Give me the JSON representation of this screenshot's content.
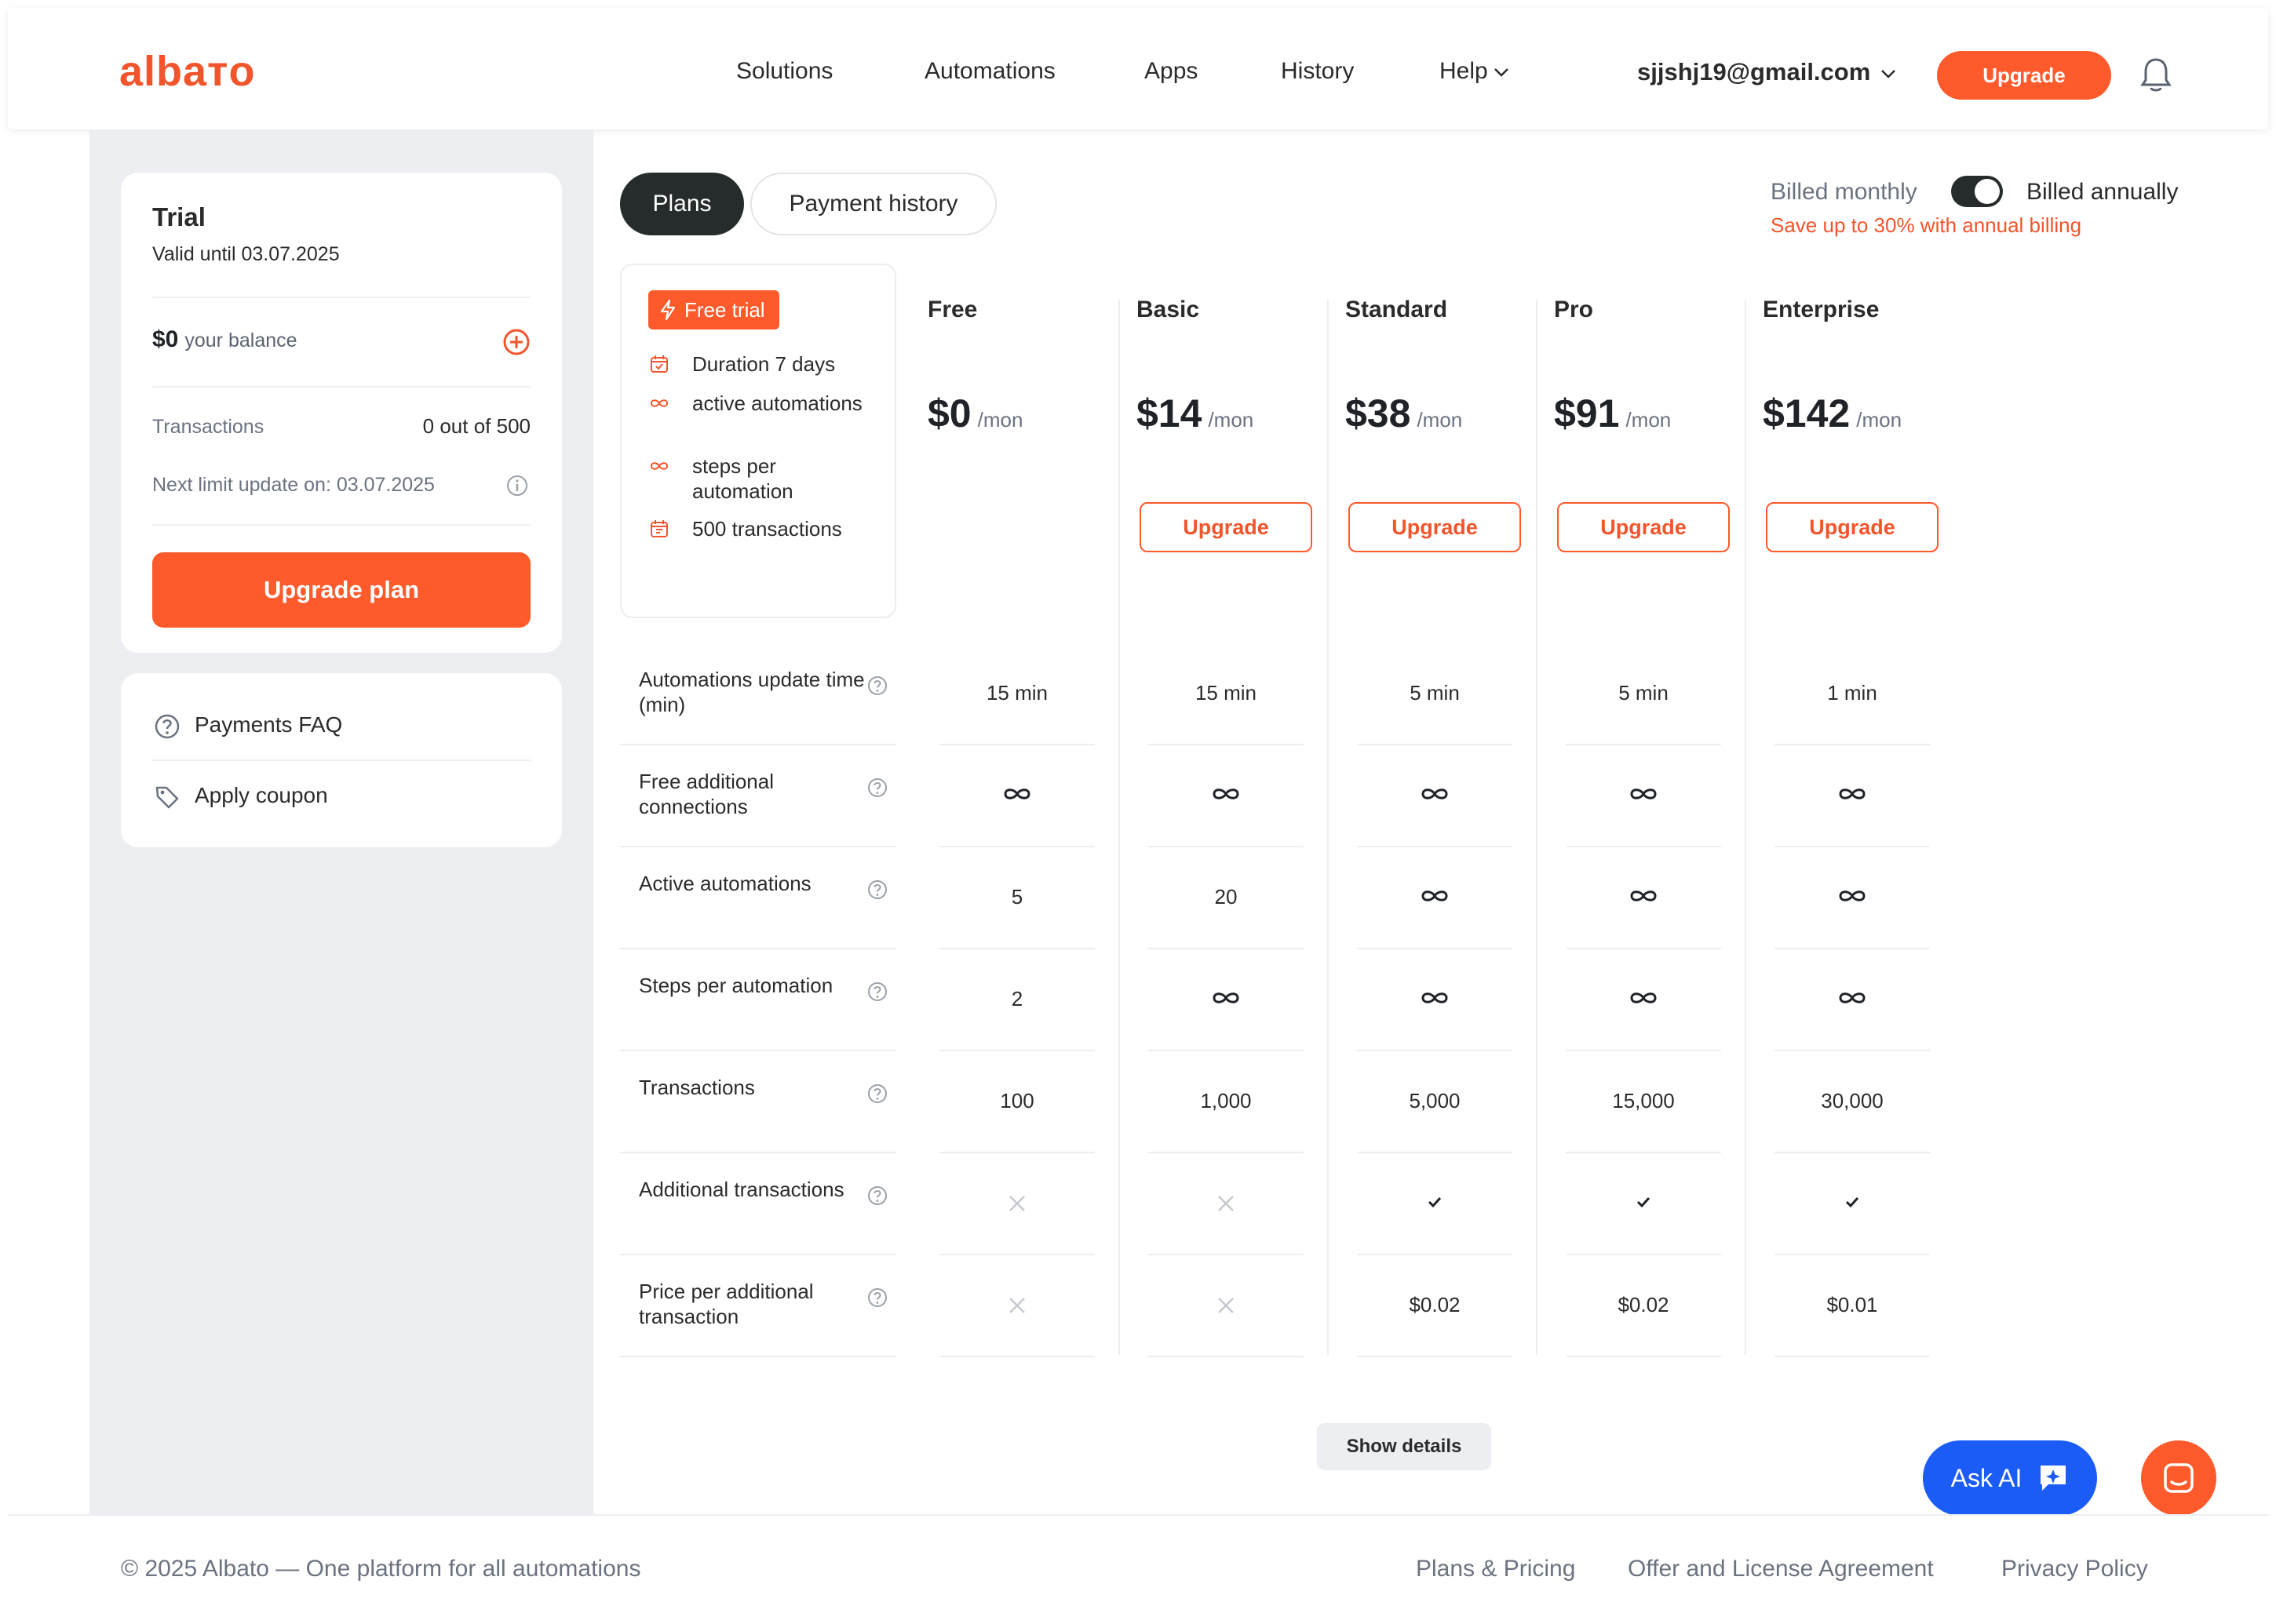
{
  "header": {
    "logo": "albaтo",
    "nav": [
      "Solutions",
      "Automations",
      "Apps",
      "History",
      "Help"
    ],
    "user_email": "sjjshj19@gmail.com",
    "upgrade_label": "Upgrade"
  },
  "sidebar": {
    "plan_title": "Trial",
    "valid_until": "Valid until 03.07.2025",
    "balance_amount": "$0",
    "balance_label": "your balance",
    "transactions_label": "Transactions",
    "transactions_value": "0 out of 500",
    "next_update": "Next limit update on: 03.07.2025",
    "upgrade_plan_label": "Upgrade plan",
    "links": [
      "Payments FAQ",
      "Apply coupon"
    ]
  },
  "tabs": [
    "Plans",
    "Payment history"
  ],
  "billing": {
    "monthly": "Billed monthly",
    "annually": "Billed annually",
    "annual_selected": true,
    "save_note": "Save up to 30% with annual billing"
  },
  "trial_box": {
    "badge": "Free trial",
    "items": [
      "Duration 7 days",
      "active automations",
      "steps per automation",
      "500 transactions"
    ]
  },
  "plans": [
    {
      "name": "Free",
      "price": "$0",
      "period": "/mon",
      "upgrade": ""
    },
    {
      "name": "Basic",
      "price": "$14",
      "period": "/mon",
      "upgrade": "Upgrade"
    },
    {
      "name": "Standard",
      "price": "$38",
      "period": "/mon",
      "upgrade": "Upgrade"
    },
    {
      "name": "Pro",
      "price": "$91",
      "period": "/mon",
      "upgrade": "Upgrade"
    },
    {
      "name": "Enterprise",
      "price": "$142",
      "period": "/mon",
      "upgrade": "Upgrade"
    }
  ],
  "features": [
    {
      "label": "Automations update time (min)",
      "values": [
        "15 min",
        "15 min",
        "5 min",
        "5 min",
        "1 min"
      ]
    },
    {
      "label": "Free additional connections",
      "values": [
        "infinity",
        "infinity",
        "infinity",
        "infinity",
        "infinity"
      ]
    },
    {
      "label": "Active automations",
      "values": [
        "5",
        "20",
        "infinity",
        "infinity",
        "infinity"
      ]
    },
    {
      "label": "Steps per automation",
      "values": [
        "2",
        "infinity",
        "infinity",
        "infinity",
        "infinity"
      ]
    },
    {
      "label": "Transactions",
      "values": [
        "100",
        "1,000",
        "5,000",
        "15,000",
        "30,000"
      ]
    },
    {
      "label": "Additional transactions",
      "values": [
        "cross",
        "cross",
        "check",
        "check",
        "check"
      ]
    },
    {
      "label": "Price per additional transaction",
      "values": [
        "cross",
        "cross",
        "$0.02",
        "$0.02",
        "$0.01"
      ]
    }
  ],
  "show_details_label": "Show details",
  "ask_ai_label": "Ask AI",
  "footer": {
    "copyright": "© 2025 Albato — One platform for all automations",
    "links": [
      "Plans & Pricing",
      "Offer and License Agreement",
      "Privacy Policy"
    ]
  },
  "colors": {
    "accent": "#ff5a2b",
    "dark": "#262b2b",
    "ask_ai": "#1a5cf5",
    "sidebar_bg": "#eceef1"
  }
}
